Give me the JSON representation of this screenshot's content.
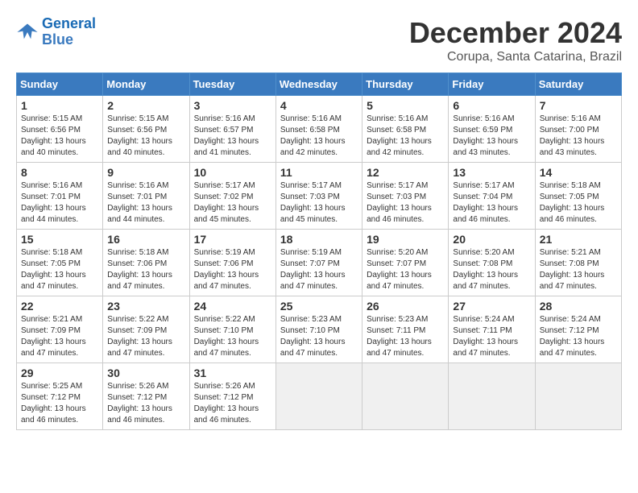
{
  "header": {
    "logo_line1": "General",
    "logo_line2": "Blue",
    "month": "December 2024",
    "location": "Corupa, Santa Catarina, Brazil"
  },
  "days_of_week": [
    "Sunday",
    "Monday",
    "Tuesday",
    "Wednesday",
    "Thursday",
    "Friday",
    "Saturday"
  ],
  "weeks": [
    [
      {
        "day": "1",
        "text": "Sunrise: 5:15 AM\nSunset: 6:56 PM\nDaylight: 13 hours\nand 40 minutes."
      },
      {
        "day": "2",
        "text": "Sunrise: 5:15 AM\nSunset: 6:56 PM\nDaylight: 13 hours\nand 40 minutes."
      },
      {
        "day": "3",
        "text": "Sunrise: 5:16 AM\nSunset: 6:57 PM\nDaylight: 13 hours\nand 41 minutes."
      },
      {
        "day": "4",
        "text": "Sunrise: 5:16 AM\nSunset: 6:58 PM\nDaylight: 13 hours\nand 42 minutes."
      },
      {
        "day": "5",
        "text": "Sunrise: 5:16 AM\nSunset: 6:58 PM\nDaylight: 13 hours\nand 42 minutes."
      },
      {
        "day": "6",
        "text": "Sunrise: 5:16 AM\nSunset: 6:59 PM\nDaylight: 13 hours\nand 43 minutes."
      },
      {
        "day": "7",
        "text": "Sunrise: 5:16 AM\nSunset: 7:00 PM\nDaylight: 13 hours\nand 43 minutes."
      }
    ],
    [
      {
        "day": "8",
        "text": "Sunrise: 5:16 AM\nSunset: 7:01 PM\nDaylight: 13 hours\nand 44 minutes."
      },
      {
        "day": "9",
        "text": "Sunrise: 5:16 AM\nSunset: 7:01 PM\nDaylight: 13 hours\nand 44 minutes."
      },
      {
        "day": "10",
        "text": "Sunrise: 5:17 AM\nSunset: 7:02 PM\nDaylight: 13 hours\nand 45 minutes."
      },
      {
        "day": "11",
        "text": "Sunrise: 5:17 AM\nSunset: 7:03 PM\nDaylight: 13 hours\nand 45 minutes."
      },
      {
        "day": "12",
        "text": "Sunrise: 5:17 AM\nSunset: 7:03 PM\nDaylight: 13 hours\nand 46 minutes."
      },
      {
        "day": "13",
        "text": "Sunrise: 5:17 AM\nSunset: 7:04 PM\nDaylight: 13 hours\nand 46 minutes."
      },
      {
        "day": "14",
        "text": "Sunrise: 5:18 AM\nSunset: 7:05 PM\nDaylight: 13 hours\nand 46 minutes."
      }
    ],
    [
      {
        "day": "15",
        "text": "Sunrise: 5:18 AM\nSunset: 7:05 PM\nDaylight: 13 hours\nand 47 minutes."
      },
      {
        "day": "16",
        "text": "Sunrise: 5:18 AM\nSunset: 7:06 PM\nDaylight: 13 hours\nand 47 minutes."
      },
      {
        "day": "17",
        "text": "Sunrise: 5:19 AM\nSunset: 7:06 PM\nDaylight: 13 hours\nand 47 minutes."
      },
      {
        "day": "18",
        "text": "Sunrise: 5:19 AM\nSunset: 7:07 PM\nDaylight: 13 hours\nand 47 minutes."
      },
      {
        "day": "19",
        "text": "Sunrise: 5:20 AM\nSunset: 7:07 PM\nDaylight: 13 hours\nand 47 minutes."
      },
      {
        "day": "20",
        "text": "Sunrise: 5:20 AM\nSunset: 7:08 PM\nDaylight: 13 hours\nand 47 minutes."
      },
      {
        "day": "21",
        "text": "Sunrise: 5:21 AM\nSunset: 7:08 PM\nDaylight: 13 hours\nand 47 minutes."
      }
    ],
    [
      {
        "day": "22",
        "text": "Sunrise: 5:21 AM\nSunset: 7:09 PM\nDaylight: 13 hours\nand 47 minutes."
      },
      {
        "day": "23",
        "text": "Sunrise: 5:22 AM\nSunset: 7:09 PM\nDaylight: 13 hours\nand 47 minutes."
      },
      {
        "day": "24",
        "text": "Sunrise: 5:22 AM\nSunset: 7:10 PM\nDaylight: 13 hours\nand 47 minutes."
      },
      {
        "day": "25",
        "text": "Sunrise: 5:23 AM\nSunset: 7:10 PM\nDaylight: 13 hours\nand 47 minutes."
      },
      {
        "day": "26",
        "text": "Sunrise: 5:23 AM\nSunset: 7:11 PM\nDaylight: 13 hours\nand 47 minutes."
      },
      {
        "day": "27",
        "text": "Sunrise: 5:24 AM\nSunset: 7:11 PM\nDaylight: 13 hours\nand 47 minutes."
      },
      {
        "day": "28",
        "text": "Sunrise: 5:24 AM\nSunset: 7:12 PM\nDaylight: 13 hours\nand 47 minutes."
      }
    ],
    [
      {
        "day": "29",
        "text": "Sunrise: 5:25 AM\nSunset: 7:12 PM\nDaylight: 13 hours\nand 46 minutes."
      },
      {
        "day": "30",
        "text": "Sunrise: 5:26 AM\nSunset: 7:12 PM\nDaylight: 13 hours\nand 46 minutes."
      },
      {
        "day": "31",
        "text": "Sunrise: 5:26 AM\nSunset: 7:12 PM\nDaylight: 13 hours\nand 46 minutes."
      },
      {
        "day": "",
        "text": ""
      },
      {
        "day": "",
        "text": ""
      },
      {
        "day": "",
        "text": ""
      },
      {
        "day": "",
        "text": ""
      }
    ]
  ]
}
